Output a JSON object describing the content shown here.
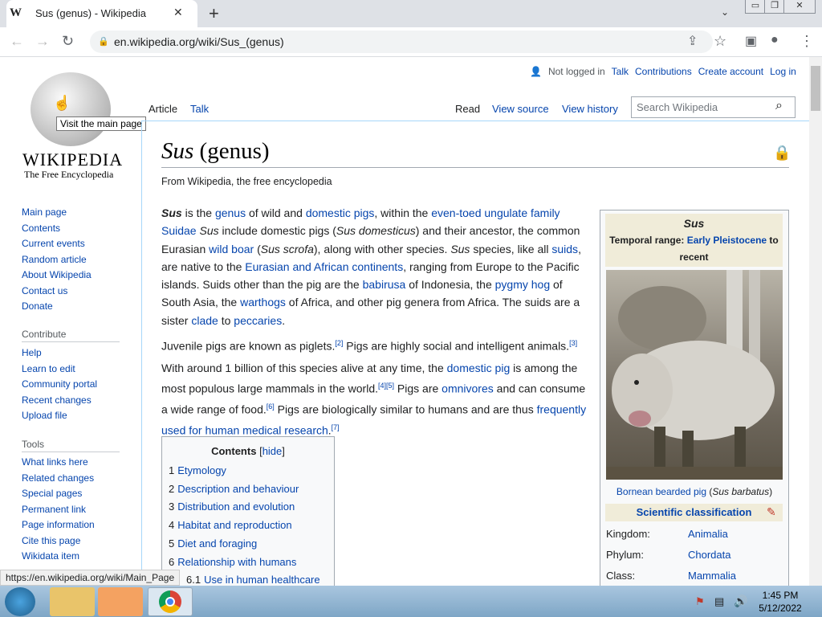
{
  "browser": {
    "tab_title": "Sus (genus) - Wikipedia",
    "tab_favicon": "W",
    "tab_close": "✕",
    "new_tab": "+",
    "tab_menu": "⌄",
    "url": "en.wikipedia.org/wiki/Sus_(genus)",
    "window_buttons": [
      "▭",
      "❐",
      "✕"
    ],
    "nav_icons": {
      "back": "←",
      "forward": "→",
      "reload": "↻",
      "share": "⇪",
      "star": "☆",
      "sidepanel": "▣",
      "profile": "●",
      "menu": "⋮"
    }
  },
  "wiki": {
    "wordmark": "WIKIPEDIA",
    "tagline": "The Free Encyclopedia",
    "logo_tooltip": "Visit the main page",
    "personal": {
      "not_logged_in": "Not logged in",
      "talk": "Talk",
      "contributions": "Contributions",
      "create_account": "Create account",
      "log_in": "Log in"
    },
    "ns_tabs": {
      "article": "Article",
      "talk": "Talk"
    },
    "view_tabs": {
      "read": "Read",
      "view_source": "View source",
      "view_history": "View history"
    },
    "search_placeholder": "Search Wikipedia",
    "sidebar": {
      "nav": [
        "Main page",
        "Contents",
        "Current events",
        "Random article",
        "About Wikipedia",
        "Contact us",
        "Donate"
      ],
      "contribute_heading": "Contribute",
      "contribute": [
        "Help",
        "Learn to edit",
        "Community portal",
        "Recent changes",
        "Upload file"
      ],
      "tools_heading": "Tools",
      "tools": [
        "What links here",
        "Related changes",
        "Special pages",
        "Permanent link",
        "Page information",
        "Cite this page",
        "Wikidata item"
      ]
    },
    "heading_italic": "Sus",
    "heading_rest": " (genus)",
    "site_sub": "From Wikipedia, the free encyclopedia",
    "para1": {
      "sus": "Sus",
      "t1": " is the ",
      "genus": "genus",
      "t2": " of wild and ",
      "domestic_pigs": "domestic pigs",
      "t3": ", within the ",
      "eveng": "even-toed ungulate family",
      "suidae": "Suidae",
      ".": ".",
      "sus2": "Sus",
      "t4": " include domestic pigs (",
      "susdom": "Sus domesticus",
      "t5": ") and their ancestor, the common Eurasian ",
      "wildboar": "wild boar",
      "t6": " (",
      "scrofa": "Sus scrofa",
      "t7": "), along with other species. ",
      "sus3": "Sus",
      "t8": " species, like all ",
      "suids": "suids",
      "t9": ", are native to the ",
      "eurasian": "Eurasian and African continents",
      "t10": ", ranging from Europe to the Pacific islands. Suids other than the pig are the ",
      "babirusa": "babirusa",
      "t11": " of Indonesia, the ",
      "pygmy": "pygmy hog",
      "t12": " of South Asia, the ",
      "warthogs": "warthogs",
      "t13": " of Africa, and other pig genera from Africa. The suids are a sister ",
      "clade": "clade",
      "t14": " to ",
      "peccaries": "peccaries",
      "t15": "."
    },
    "para2": {
      "t1": "Juvenile pigs are known as piglets.",
      "ref2": "[2]",
      "t2": " Pigs are highly social and intelligent animals.",
      "ref3": "[3]"
    },
    "para3": {
      "t1": "With around 1 billion of this species alive at any time, the ",
      "dompig": "domestic pig",
      "t2": " is among the most populous large mammals in the world.",
      "ref45": "[4][5]",
      "t3": " Pigs are ",
      "omni": "omnivores",
      "t4": " and can consume a wide range of food.",
      "ref6": "[6]",
      "t5": " Pigs are biologically similar to humans and are thus ",
      "freq": "frequently used for human medical research",
      "t6": ".",
      "ref7": "[7]"
    },
    "toc": {
      "title": "Contents",
      "hide": "hide",
      "items": [
        {
          "num": "1",
          "label": "Etymology"
        },
        {
          "num": "2",
          "label": "Description and behaviour"
        },
        {
          "num": "3",
          "label": "Distribution and evolution"
        },
        {
          "num": "4",
          "label": "Habitat and reproduction"
        },
        {
          "num": "5",
          "label": "Diet and foraging"
        },
        {
          "num": "6",
          "label": "Relationship with humans"
        },
        {
          "num": "6.1",
          "label": "Use in human healthcare"
        }
      ]
    },
    "infobox": {
      "title": "Sus",
      "range_label": "Temporal range: ",
      "range_link": "Early Pleistocene",
      "range_to": " to recent",
      "caption_link": "Bornean bearded pig",
      "caption_sci": "Sus barbatus",
      "sci_class": "Scientific classification",
      "rows": [
        {
          "k": "Kingdom:",
          "v": "Animalia"
        },
        {
          "k": "Phylum:",
          "v": "Chordata"
        },
        {
          "k": "Class:",
          "v": "Mammalia"
        }
      ]
    },
    "status_url": "https://en.wikipedia.org/wiki/Main_Page"
  },
  "taskbar": {
    "time": "1:45 PM",
    "date": "5/12/2022"
  }
}
